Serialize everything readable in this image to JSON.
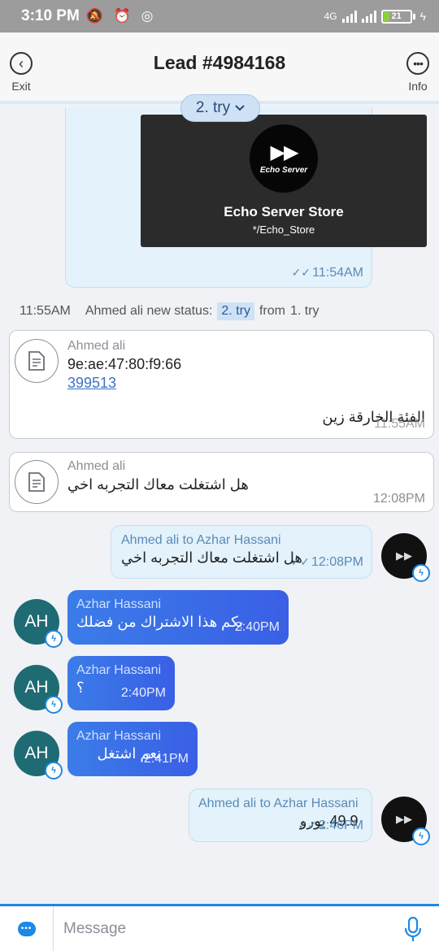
{
  "status_bar": {
    "time": "3:10 PM",
    "icons": "🔕 ⏰ ◎",
    "network": "4G",
    "battery": "21",
    "battery_fraction": 0.21
  },
  "header": {
    "title": "Lead #4984168",
    "exit_label": "Exit",
    "info_label": "Info"
  },
  "try_pill": {
    "label": "2. try"
  },
  "messages": {
    "image_message": {
      "logo_text": "Echo Server",
      "store_name": "Echo Server Store",
      "handle": "*/Echo_Store",
      "time": "11:54AM"
    },
    "status_change": {
      "time": "11:55AM",
      "text": "Ahmed ali new status:",
      "new_status": "2. try",
      "from_text": "from",
      "old_status": "1. try"
    },
    "note1": {
      "sender": "Ahmed ali",
      "line1": "9e:ae:47:80:f9:66",
      "link": "399513",
      "arabic": "الفئة الخارقة زين",
      "time": "11:55AM"
    },
    "note2": {
      "sender": "Ahmed ali",
      "text": "هل اشتغلت معاك التجربه اخي",
      "time": "12:08PM"
    },
    "out1": {
      "sender": "Ahmed ali to Azhar Hassani",
      "text": "هل اشتغلت معاك التجربه اخي",
      "time": "12:08PM"
    },
    "in1": {
      "avatar": "AH",
      "sender": "Azhar Hassani",
      "text": "بكم هذا الاشتراك من فضلك",
      "time": "2:40PM"
    },
    "in2": {
      "avatar": "AH",
      "sender": "Azhar Hassani",
      "text": "؟",
      "time": "2:40PM"
    },
    "in3": {
      "avatar": "AH",
      "sender": "Azhar Hassani",
      "text": "نعم اشتغل",
      "time": "2:41PM"
    },
    "out2": {
      "sender": "Ahmed ali to Azhar Hassani",
      "text": "49.9 يورو",
      "time": "2:46PM"
    }
  },
  "composer": {
    "placeholder": "Message",
    "value": ""
  },
  "colors": {
    "accent": "#1e88e5",
    "incoming_bubble": "#3b6fe6",
    "outgoing_bubble": "#e3f2fb"
  }
}
